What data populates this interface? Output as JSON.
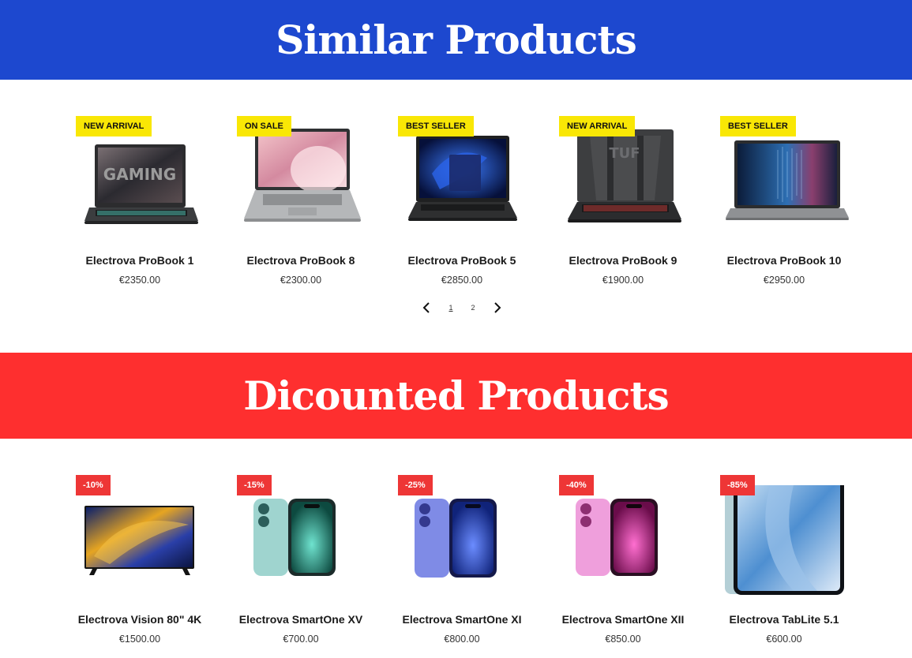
{
  "similar_section": {
    "title": "Similar Products",
    "products": [
      {
        "badge": "NEW ARRIVAL",
        "name": "Electrova ProBook 1",
        "price": "€2350.00",
        "image_icon": "gaming-laptop-icon"
      },
      {
        "badge": "ON SALE",
        "name": "Electrova ProBook 8",
        "price": "€2300.00",
        "image_icon": "silver-laptop-icon"
      },
      {
        "badge": "BEST SELLER",
        "name": "Electrova ProBook 5",
        "price": "€2850.00",
        "image_icon": "windows-laptop-icon"
      },
      {
        "badge": "NEW ARRIVAL",
        "name": "Electrova ProBook 9",
        "price": "€1900.00",
        "image_icon": "tuf-laptop-icon"
      },
      {
        "badge": "BEST SELLER",
        "name": "Electrova ProBook 10",
        "price": "€2950.00",
        "image_icon": "business-laptop-icon"
      }
    ],
    "pagination": {
      "pages": [
        "1",
        "2"
      ],
      "current": "1"
    }
  },
  "discount_section": {
    "title": "Dicounted Products",
    "products": [
      {
        "badge": "-10%",
        "name": "Electrova Vision 80\" 4K",
        "price": "€1500.00",
        "image_icon": "tv-icon"
      },
      {
        "badge": "-15%",
        "name": "Electrova SmartOne XV",
        "price": "€700.00",
        "image_icon": "teal-phone-icon"
      },
      {
        "badge": "-25%",
        "name": "Electrova SmartOne XI",
        "price": "€800.00",
        "image_icon": "blue-phone-icon"
      },
      {
        "badge": "-40%",
        "name": "Electrova SmartOne XII",
        "price": "€850.00",
        "image_icon": "pink-phone-icon"
      },
      {
        "badge": "-85%",
        "name": "Electrova TabLite 5.1",
        "price": "€600.00",
        "image_icon": "tablet-icon"
      }
    ]
  },
  "colors": {
    "similar_banner": "#1d48cf",
    "discount_banner": "#fe2f2f",
    "badge_yellow": "#f9e705",
    "badge_red": "#ee3636"
  }
}
